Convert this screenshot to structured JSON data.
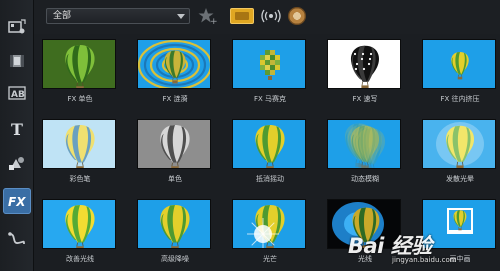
{
  "toolbar": {
    "dropdown_value": "全部"
  },
  "effects": [
    {
      "label": "FX 单色",
      "style": "fx-mono-green"
    },
    {
      "label": "FX 涟漪",
      "style": "fx-ripple"
    },
    {
      "label": "FX 马赛克",
      "style": "fx-mosaic"
    },
    {
      "label": "FX 速写",
      "style": "fx-sketch"
    },
    {
      "label": "FX 往内挤压",
      "style": "fx-pinch"
    },
    {
      "label": "彩色笔",
      "style": "color-pen"
    },
    {
      "label": "单色",
      "style": "mono-gray"
    },
    {
      "label": "抵消摇动",
      "style": "stabilize"
    },
    {
      "label": "动态模糊",
      "style": "motion-blur"
    },
    {
      "label": "发散光晕",
      "style": "diffuse-glow"
    },
    {
      "label": "改善光线",
      "style": "improve-light"
    },
    {
      "label": "高级降噪",
      "style": "denoise"
    },
    {
      "label": "光芒",
      "style": "rays"
    },
    {
      "label": "光线",
      "style": "lighting"
    },
    {
      "label": "画中画",
      "style": "pip"
    }
  ],
  "watermark": {
    "brand": "Bai 经验",
    "url": "jingyan.baidu.com"
  },
  "colors": {
    "sky": "#1e9fe8",
    "balloon_yellow": "#e8d12a",
    "balloon_green": "#3f8a2a",
    "active_tool": "#3a6ea5"
  }
}
